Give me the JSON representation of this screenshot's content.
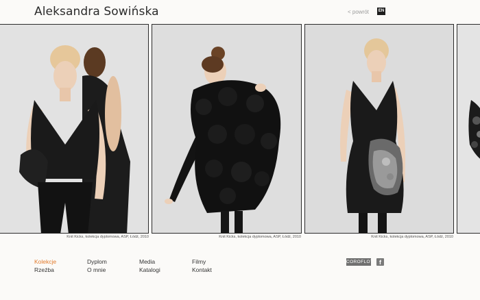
{
  "header": {
    "title": "Aleksandra Sowińska",
    "back_label": "< powrót",
    "lang_label": "EN"
  },
  "gallery": {
    "captions": [
      "Knit Kicks, kolekcja dyplomowa, ASP, Łódź, 2010",
      "Knit Kicks, kolekcja dyplomowa, ASP, Łódź, 2010",
      "Knit Kicks, kolekcja dyplomowa, ASP, Łódź, 2010"
    ]
  },
  "nav": {
    "col1": [
      "Kolekcje",
      "Rzeźba"
    ],
    "col2": [
      "Dyplom",
      "O mnie"
    ],
    "col3": [
      "Media",
      "Katalogi"
    ],
    "col4": [
      "Filmy",
      "Kontakt"
    ],
    "active": "Kolekcje"
  },
  "social": {
    "coroflot_label": "COROFLOT",
    "facebook_label": "f"
  },
  "colors": {
    "accent": "#e27b2c",
    "background": "#fbfaf8"
  }
}
